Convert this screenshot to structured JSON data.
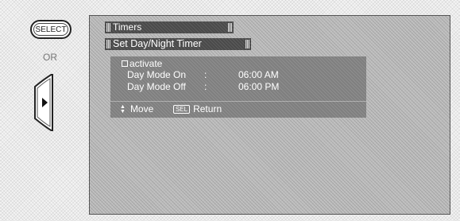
{
  "remote": {
    "select_label": "SELECT",
    "or_label": "OR",
    "rocker_icon": "right-arrow-icon"
  },
  "menu": {
    "title": "Timers",
    "subtitle": "Set Day/Night Timer",
    "activate": {
      "label": "activate",
      "checked": false
    },
    "day_mode_on": {
      "label": "Day Mode On",
      "sep": ":",
      "value": "06:00 AM"
    },
    "day_mode_off": {
      "label": "Day Mode Off",
      "sep": ":",
      "value": "06:00 PM"
    },
    "footer": {
      "move_label": "Move",
      "sel_badge": "SEL",
      "return_label": "Return"
    }
  }
}
